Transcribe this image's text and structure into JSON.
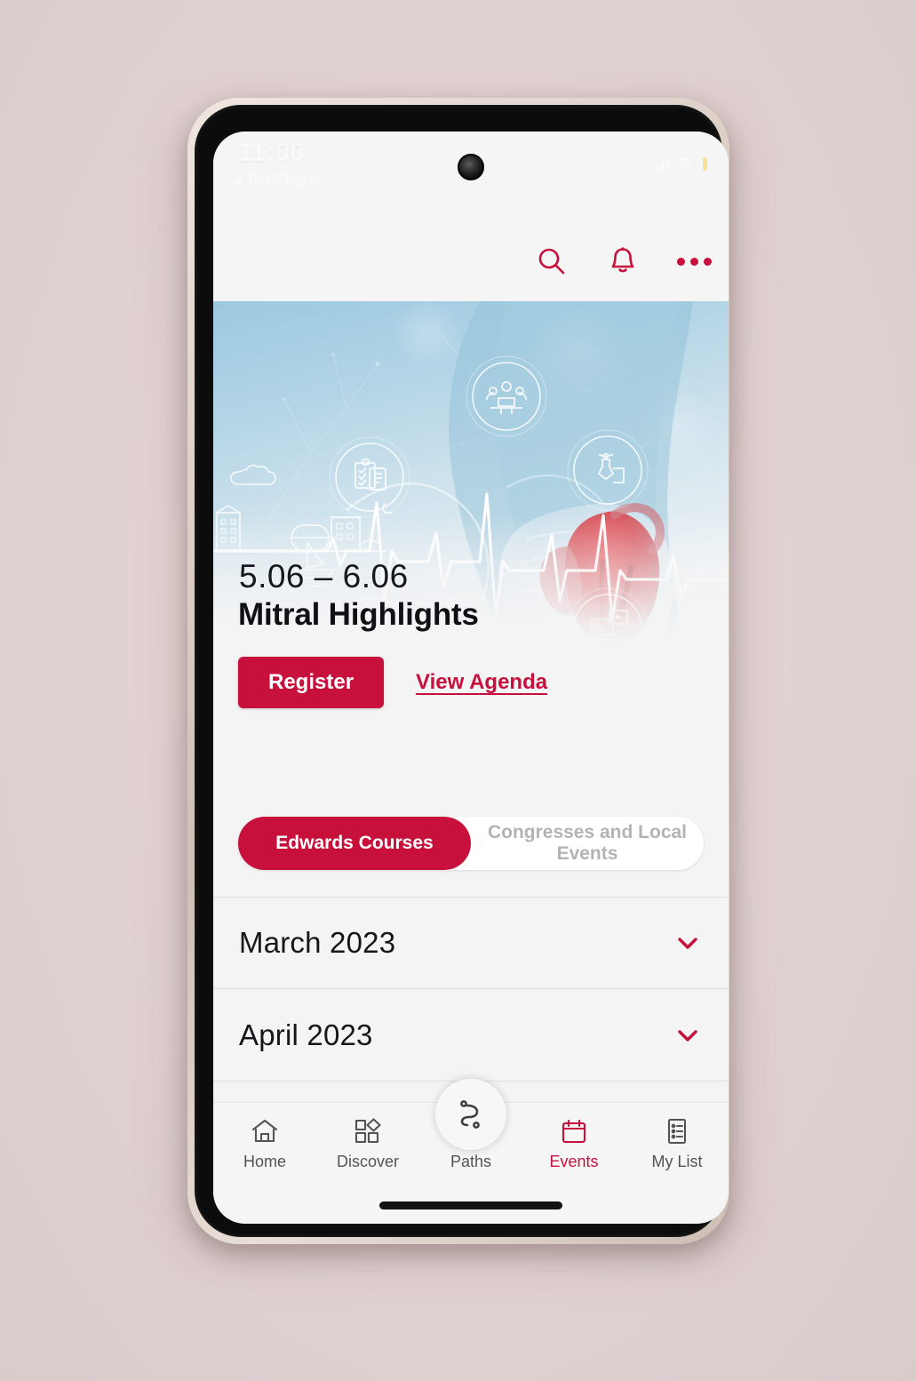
{
  "device": {
    "frame_color": "#dccfc6",
    "bezel_color": "#0d0c0c",
    "screen_bg": "#f4f4f4"
  },
  "statusbar": {
    "time": "11:00",
    "app_name": "TestFlight",
    "back_arrow": "◀",
    "icons": {
      "signal": "signal-bars-icon",
      "wifi": "wifi-icon",
      "battery": "battery-icon"
    },
    "battery_color": "#f3d44c"
  },
  "header": {
    "search_icon": "search-icon",
    "notifications_icon": "bell-icon",
    "more_icon": "more-horizontal-icon",
    "accent": "#c8103c"
  },
  "hero": {
    "alt": "cardiac illustration with hand holding heart, ECG waveform, city skyline and circular medical icons",
    "icons": [
      "people-meeting-icon",
      "clipboard-checklist-icon",
      "ultrasound-probe-icon",
      "heart-icon",
      "laptop-video-icon"
    ]
  },
  "event": {
    "dates": "5.06 – 6.06",
    "title": "Mitral Highlights",
    "register_label": "Register",
    "agenda_label": "View Agenda"
  },
  "segmented": {
    "options": [
      {
        "label": "Edwards Courses",
        "active": true
      },
      {
        "label": "Congresses and Local Events",
        "active": false
      }
    ],
    "active_bg": "#c8103c",
    "inactive_text": "#b3b3b3"
  },
  "months": [
    {
      "label": "March 2023",
      "chevron": "chevron-down-icon",
      "expanded": false
    },
    {
      "label": "April 2023",
      "chevron": "chevron-down-icon",
      "expanded": false
    }
  ],
  "bottom_nav": {
    "items": [
      {
        "label": "Home",
        "icon": "home-icon",
        "active": false
      },
      {
        "label": "Discover",
        "icon": "discover-shapes-icon",
        "active": false
      },
      {
        "label": "Paths",
        "icon": "path-route-icon",
        "active": false
      },
      {
        "label": "Events",
        "icon": "calendar-icon",
        "active": true
      },
      {
        "label": "My List",
        "icon": "list-document-icon",
        "active": false
      }
    ],
    "active_color": "#c8103c",
    "inactive_color": "#545456"
  }
}
